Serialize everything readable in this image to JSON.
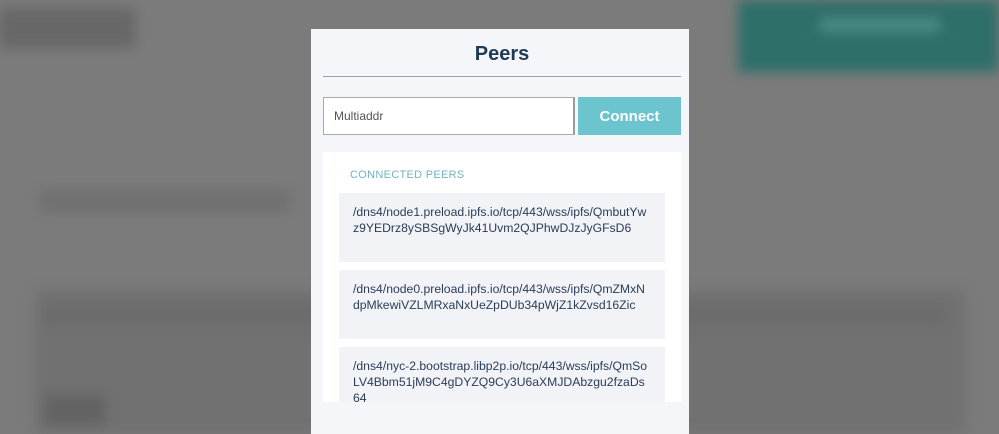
{
  "modal": {
    "title": "Peers",
    "input_placeholder": "Multiaddr",
    "input_value": "",
    "connect_label": "Connect",
    "peers_heading": "Connected Peers",
    "peers": [
      {
        "address": "/dns4/node1.preload.ipfs.io/tcp/443/wss/ipfs/QmbutYwz9YEDrz8ySBSgWyJk41Uvm2QJPhwDJzJyGFsD6"
      },
      {
        "address": "/dns4/node0.preload.ipfs.io/tcp/443/wss/ipfs/QmZMxNdpMkewiVZLMRxaNxUeZpDUb34pWjZ1kZvsd16Zic"
      },
      {
        "address": "/dns4/nyc-2.bootstrap.libp2p.io/tcp/443/wss/ipfs/QmSoLV4Bbm51jM9C4gDYZQ9Cy3U6aXMJDAbzgu2fzaDs64"
      }
    ]
  },
  "colors": {
    "title": "#1e3a56",
    "connect_button": "#6cc4cf",
    "heading_accent": "#6fb3c0",
    "overlay": "#7b7b7b"
  }
}
